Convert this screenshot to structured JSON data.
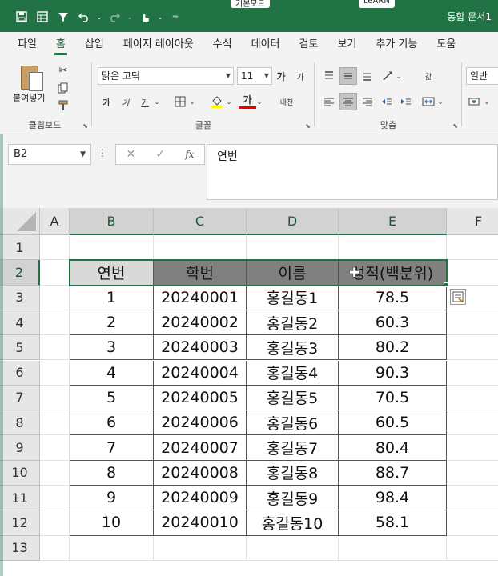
{
  "titlebar": {
    "doc_title": "통합 문서1",
    "tab_peek_1": "기본모드",
    "tab_peek_2": "LeARN",
    "customize_label": "="
  },
  "ribbon_tabs": [
    {
      "label": "파일"
    },
    {
      "label": "홈"
    },
    {
      "label": "삽입"
    },
    {
      "label": "페이지 레이아웃"
    },
    {
      "label": "수식"
    },
    {
      "label": "데이터"
    },
    {
      "label": "검토"
    },
    {
      "label": "보기"
    },
    {
      "label": "추가 기능"
    },
    {
      "label": "도움"
    }
  ],
  "active_tab": "홈",
  "ribbon": {
    "clipboard": {
      "paste_label": "붙여넣기",
      "group_label": "클립보드"
    },
    "font": {
      "font_name": "맑은 고딕",
      "font_size": "11",
      "group_label": "글꼴",
      "grow_label": "가",
      "shrink_label": "가",
      "bold_label": "가",
      "italic_label": "가",
      "underline_label": "가",
      "fontcolor_label": "가",
      "phonetic_label": "내천"
    },
    "alignment": {
      "group_label": "맞춤",
      "wrap_label": "갋"
    },
    "number": {
      "format_value": "일반"
    }
  },
  "formula_bar": {
    "name_box": "B2",
    "fx_label": "fx",
    "content": "연번"
  },
  "sheet": {
    "columns": [
      "A",
      "B",
      "C",
      "D",
      "E",
      "F"
    ],
    "rows": [
      "1",
      "2",
      "3",
      "4",
      "5",
      "6",
      "7",
      "8",
      "9",
      "10",
      "11",
      "12",
      "13"
    ],
    "selected_columns": [
      "B",
      "C",
      "D",
      "E"
    ],
    "selected_row": "2",
    "active_cell": "B2",
    "headers": [
      "연번",
      "학번",
      "이름",
      "성적(백분위)"
    ],
    "records": [
      [
        "1",
        "20240001",
        "홍길동1",
        "78.5"
      ],
      [
        "2",
        "20240002",
        "홍길동2",
        "60.3"
      ],
      [
        "3",
        "20240003",
        "홍길동3",
        "80.2"
      ],
      [
        "4",
        "20240004",
        "홍길동4",
        "90.3"
      ],
      [
        "5",
        "20240005",
        "홍길동5",
        "70.5"
      ],
      [
        "6",
        "20240006",
        "홍길동6",
        "60.5"
      ],
      [
        "7",
        "20240007",
        "홍길동7",
        "80.4"
      ],
      [
        "8",
        "20240008",
        "홍길동8",
        "88.7"
      ],
      [
        "9",
        "20240009",
        "홍길동9",
        "98.4"
      ],
      [
        "10",
        "20240010",
        "홍길동10",
        "58.1"
      ]
    ]
  },
  "colors": {
    "excel_green": "#217346",
    "header_fill": "#808080",
    "active_cell_fill": "#d9d9d9"
  }
}
